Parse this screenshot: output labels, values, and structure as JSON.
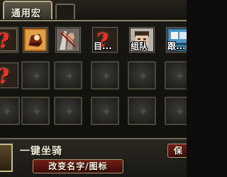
{
  "tabs": {
    "active_label": "通用宏"
  },
  "grid": {
    "row1": [
      {
        "icon": "macro-question-icon",
        "label": ""
      },
      {
        "icon": "mount-ride-icon",
        "label": ""
      },
      {
        "icon": "warrior-portrait-icon",
        "label": ""
      },
      {
        "icon": "macro-question-icon",
        "label": "目..."
      },
      {
        "icon": "face-portrait-icon",
        "label": "组队"
      },
      {
        "icon": "follow-icon",
        "label": "跟..."
      }
    ],
    "row2": [
      {
        "icon": "macro-question-icon",
        "label": ""
      }
    ],
    "empty_slot_icon": "empty-slot-emblem-icon"
  },
  "bottom": {
    "macro_name": "一键坐骑",
    "rename_label": "改变名字/图标",
    "save_label": "保"
  },
  "colors": {
    "accent_red": "#ff2a1c",
    "button_red": "#6e1e14",
    "frame_gold": "#b7ab88"
  }
}
